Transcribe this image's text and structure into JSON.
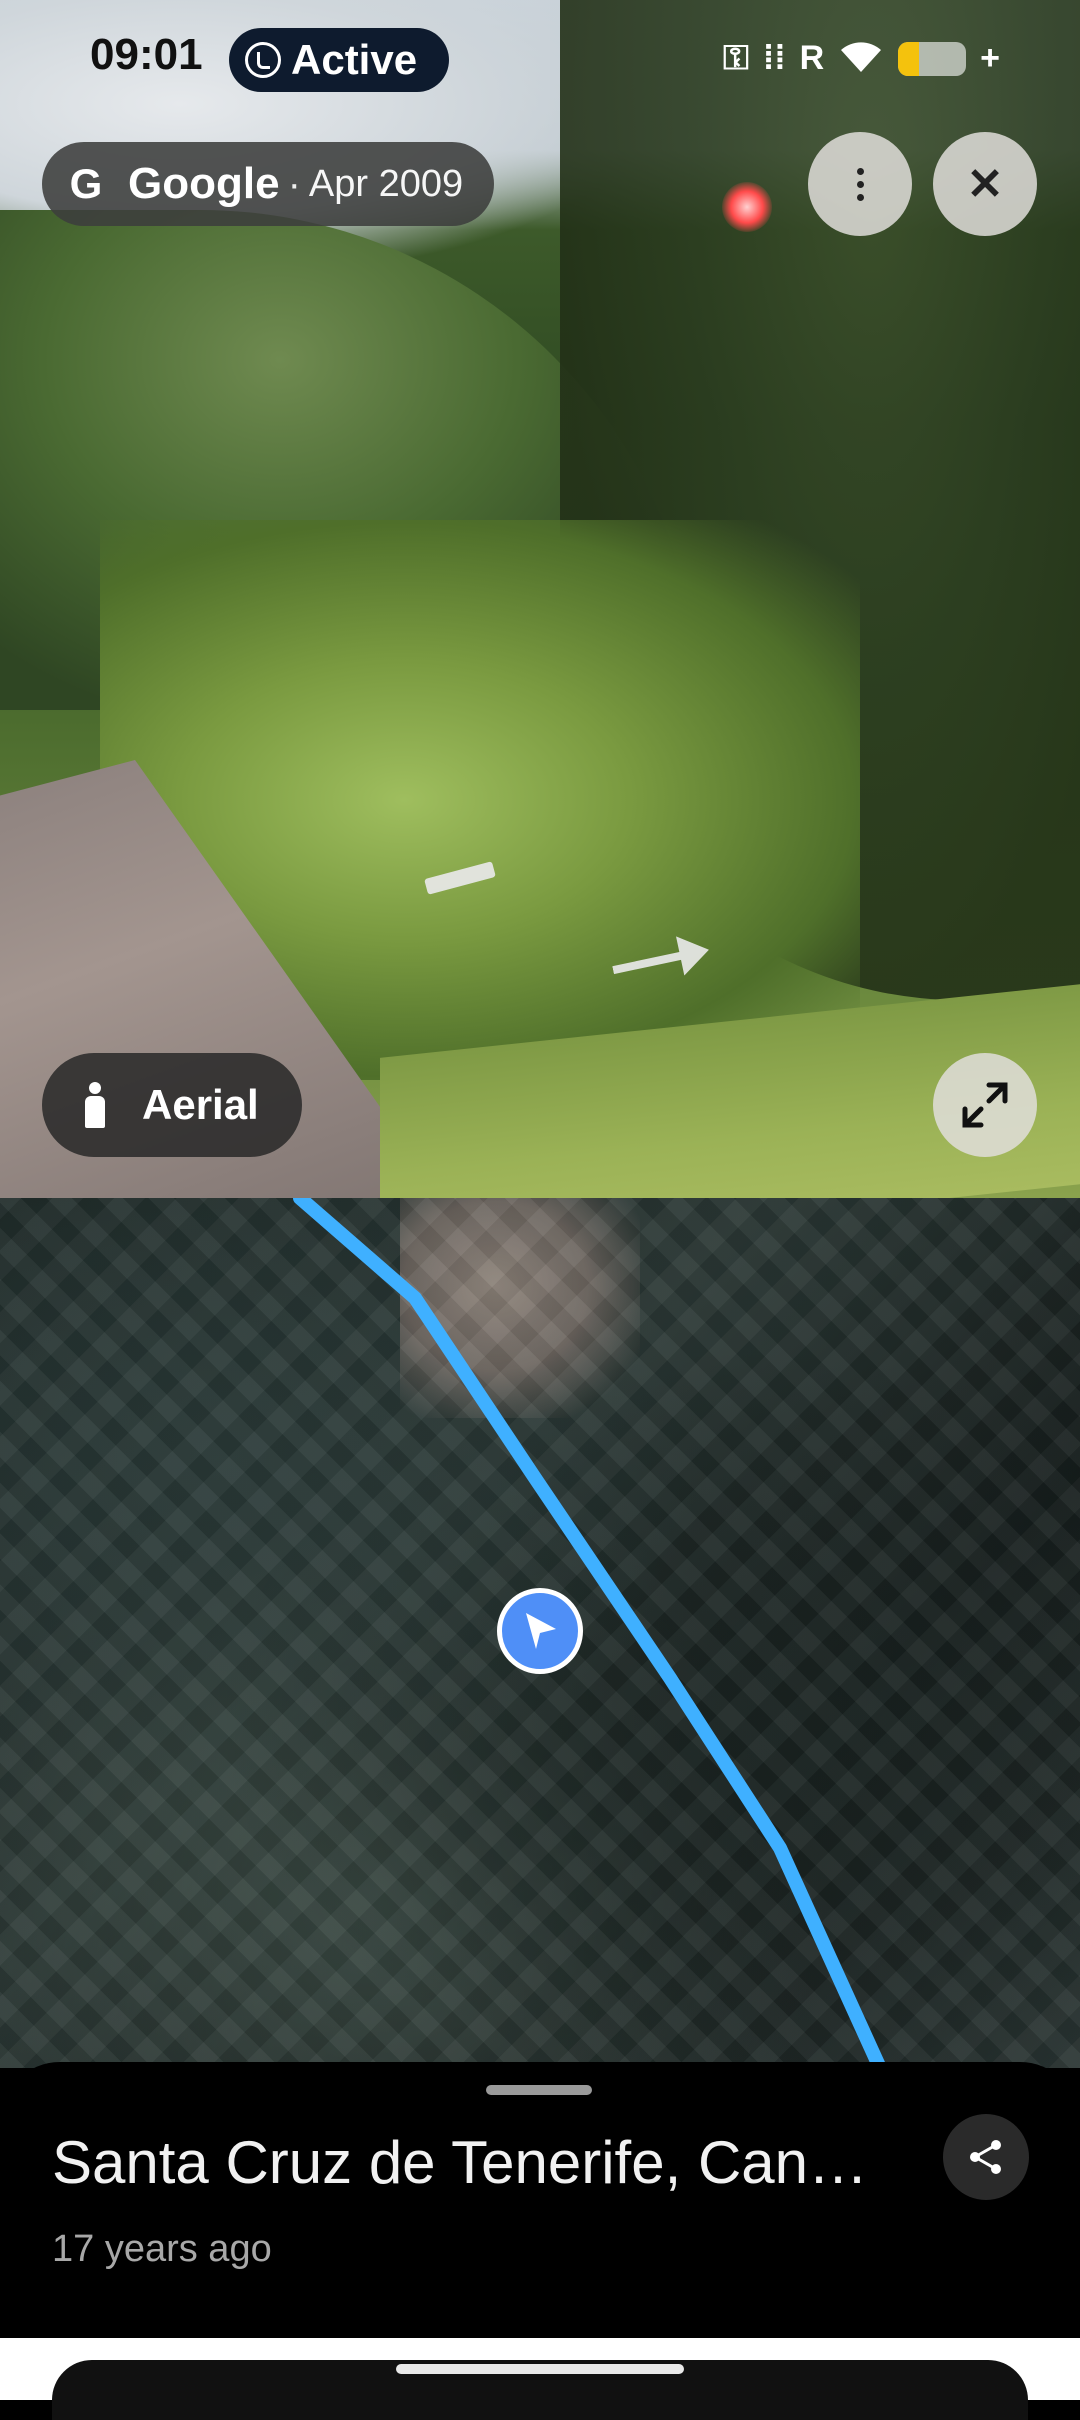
{
  "status_bar": {
    "time": "09:01",
    "active_label": "Active",
    "icons": [
      "key-icon",
      "signal-icon",
      "roaming-r-icon",
      "wifi-icon",
      "battery-icon"
    ],
    "roaming": "R",
    "battery_color": "#f4c20d",
    "battery_level": 0.3
  },
  "streetview": {
    "provider": "Google",
    "date": "Apr 2009",
    "mode_button_label": "Aerial"
  },
  "map": {
    "route_color": "#3fb0ff",
    "location_marker_color": "#4f8ff7"
  },
  "place": {
    "title": "Santa Cruz de Tenerife, Can…",
    "subtitle": "17 years ago"
  }
}
